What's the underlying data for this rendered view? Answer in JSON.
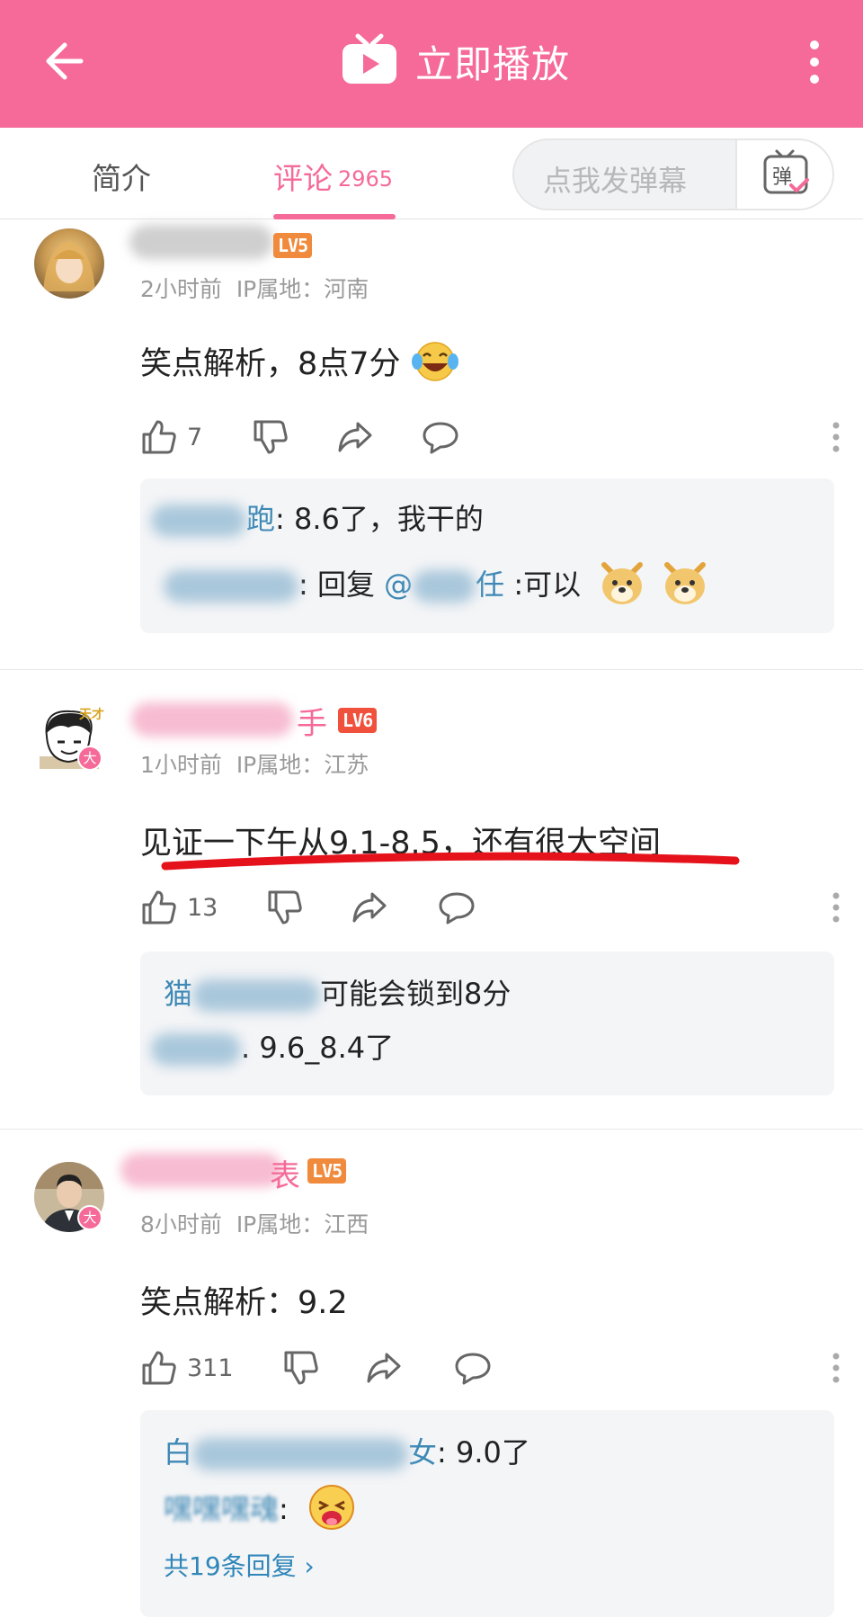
{
  "header": {
    "title": "立即播放"
  },
  "tabs": {
    "intro": "简介",
    "comments": "评论",
    "comment_count": "2965",
    "danmaku_placeholder": "点我发弹幕",
    "danmaku_button": "弹"
  },
  "colors": {
    "brand": "#f56a98",
    "link": "#3d88b5",
    "lv5": "#f08a3c",
    "lv6": "#f0513c",
    "annotation": "#e5121b"
  },
  "comments": [
    {
      "level": "LV5",
      "time": "2小时前",
      "ip": "IP属地：河南",
      "text": "笑点解析，8点7分",
      "emoji": "face-with-tears-of-joy",
      "likes": "7",
      "replies": [
        {
          "name_tail": "跑",
          "text": ": 8.6了，我干的"
        },
        {
          "name_tail": "",
          "sep": ": 回复 ",
          "mention_prefix": "@",
          "mention_tail": "任",
          "text": " :可以"
        }
      ]
    },
    {
      "name_tail": "手",
      "level": "LV6",
      "badge": "大",
      "time": "1小时前",
      "ip": "IP属地：江苏",
      "text": "见证一下午从9.1-8.5，还有很大空间",
      "likes": "13",
      "replies": [
        {
          "name_head": "猫",
          "text": "可能会锁到8分"
        },
        {
          "text": ". 9.6_8.4了"
        }
      ]
    },
    {
      "name_tail": "表",
      "level": "LV5",
      "badge": "大",
      "time": "8小时前",
      "ip": "IP属地：江西",
      "text": "笑点解析：9.2",
      "likes": "311",
      "replies": [
        {
          "name_head": "白",
          "name_tail": "女",
          "text": ": 9.0了"
        },
        {
          "name_head": "嘿嘿嘿魂",
          "text": ":"
        }
      ],
      "more_replies": "共19条回复 ›"
    }
  ]
}
